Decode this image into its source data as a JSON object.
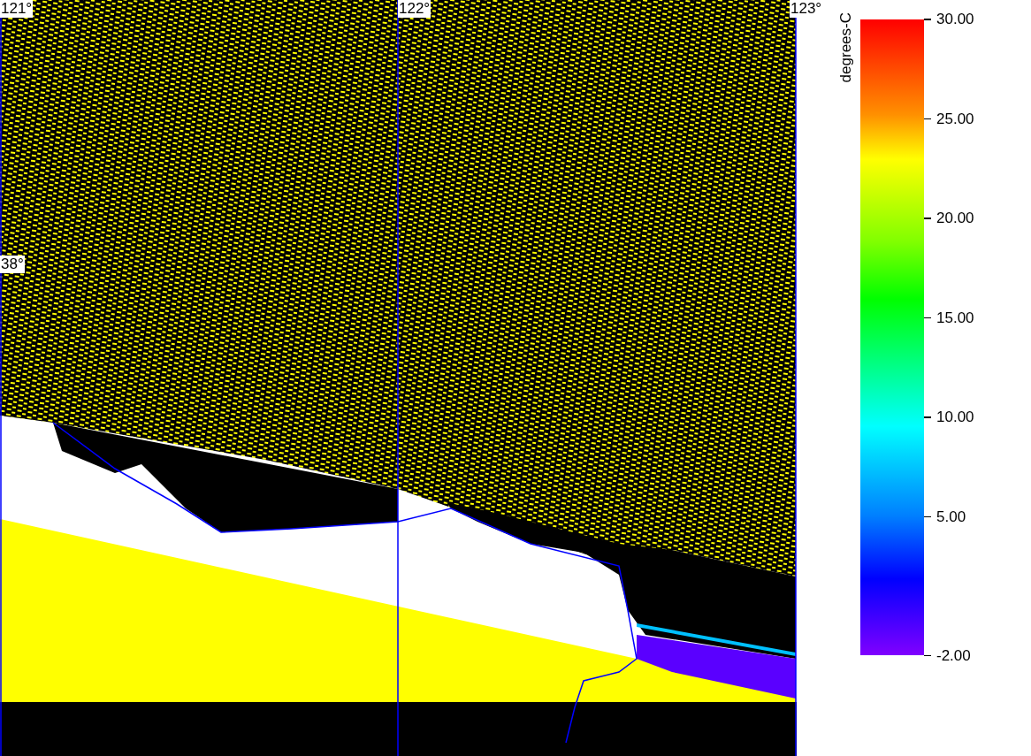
{
  "map": {
    "longitude_labels": [
      "121°",
      "122°",
      "123°"
    ],
    "latitude_labels": [
      "38°"
    ]
  },
  "legend": {
    "title": "degrees-C",
    "tick_labels": [
      "30.00",
      "25.00",
      "20.00",
      "15.00",
      "10.00",
      "5.00",
      "-2.00"
    ]
  }
}
